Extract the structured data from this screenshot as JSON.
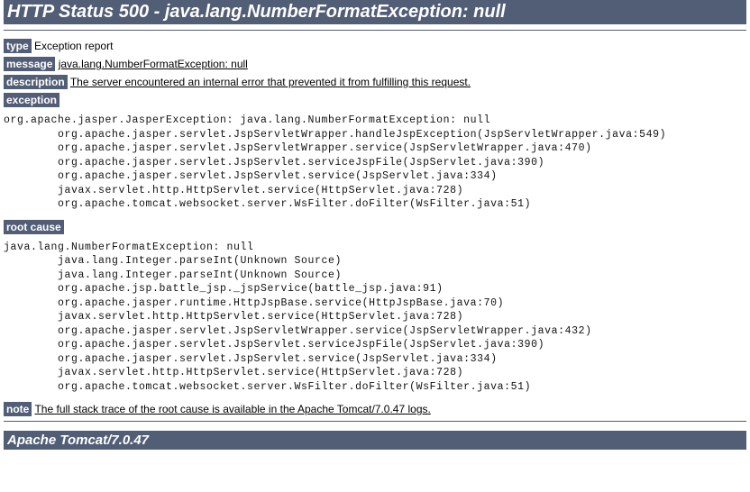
{
  "title": "HTTP Status 500 - java.lang.NumberFormatException: null",
  "labels": {
    "type": "type",
    "message": "message",
    "description": "description",
    "exception": "exception",
    "root_cause": "root cause",
    "note": "note"
  },
  "values": {
    "type": " Exception report",
    "message": "java.lang.NumberFormatException: null",
    "description": "The server encountered an internal error that prevented it from fulfilling this request.",
    "note": "The full stack trace of the root cause is available in the Apache Tomcat/7.0.47 logs."
  },
  "exception_trace": "org.apache.jasper.JasperException: java.lang.NumberFormatException: null\n\torg.apache.jasper.servlet.JspServletWrapper.handleJspException(JspServletWrapper.java:549)\n\torg.apache.jasper.servlet.JspServletWrapper.service(JspServletWrapper.java:470)\n\torg.apache.jasper.servlet.JspServlet.serviceJspFile(JspServlet.java:390)\n\torg.apache.jasper.servlet.JspServlet.service(JspServlet.java:334)\n\tjavax.servlet.http.HttpServlet.service(HttpServlet.java:728)\n\torg.apache.tomcat.websocket.server.WsFilter.doFilter(WsFilter.java:51)",
  "root_cause_trace": "java.lang.NumberFormatException: null\n\tjava.lang.Integer.parseInt(Unknown Source)\n\tjava.lang.Integer.parseInt(Unknown Source)\n\torg.apache.jsp.battle_jsp._jspService(battle_jsp.java:91)\n\torg.apache.jasper.runtime.HttpJspBase.service(HttpJspBase.java:70)\n\tjavax.servlet.http.HttpServlet.service(HttpServlet.java:728)\n\torg.apache.jasper.servlet.JspServletWrapper.service(JspServletWrapper.java:432)\n\torg.apache.jasper.servlet.JspServlet.serviceJspFile(JspServlet.java:390)\n\torg.apache.jasper.servlet.JspServlet.service(JspServlet.java:334)\n\tjavax.servlet.http.HttpServlet.service(HttpServlet.java:728)\n\torg.apache.tomcat.websocket.server.WsFilter.doFilter(WsFilter.java:51)",
  "footer": "Apache Tomcat/7.0.47"
}
